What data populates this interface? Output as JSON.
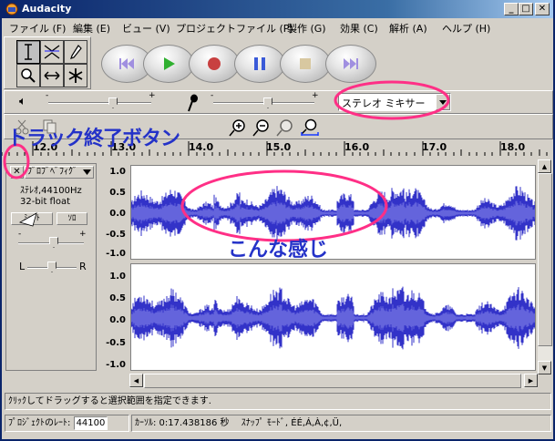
{
  "window": {
    "title": "Audacity"
  },
  "menu": [
    {
      "label": "ファイル (F)"
    },
    {
      "label": "編集 (E)"
    },
    {
      "label": "ビュー (V)"
    },
    {
      "label": "プロジェクトファイル (P)"
    },
    {
      "label": "製作 (G)"
    },
    {
      "label": "効果 (C)"
    },
    {
      "label": "解析 (A)"
    },
    {
      "label": "ヘルプ (H)"
    }
  ],
  "mixer": {
    "input_source": "ステレオ ミキサー",
    "meter_minus": "-",
    "meter_plus": "+"
  },
  "ruler": {
    "labels": [
      "12.0",
      "13.0",
      "14.0",
      "15.0",
      "16.0",
      "17.0",
      "18.0"
    ]
  },
  "track": {
    "name": "ﾌﾞﾛﾌﾞﾍﾞﾌｨｸﾞ",
    "info_rate": "ｽﾃﾚｵ,44100Hz",
    "info_format": "32-bit float",
    "mute_label": "ﾐｭｰﾄ",
    "solo_label": "ｿﾛ",
    "pan_left": "L",
    "pan_right": "R",
    "gain_minus": "-",
    "gain_plus": "+",
    "close_glyph": "✕",
    "scale_top": [
      "1.0",
      "0.5",
      "0.0",
      "-0.5",
      "-1.0"
    ],
    "scale_bottom": [
      "1.0",
      "0.5",
      "0.0",
      "-0.5",
      "-1.0"
    ]
  },
  "annotations": {
    "close_button_label": "トラック終了ボタン",
    "waveform_label": "こんな感じ"
  },
  "status": {
    "line1": "ｸﾘｯｸしてドラッグすると選択範囲を指定できます.",
    "project_rate_label": "ﾌﾟﾛｼﾞｪｸﾄのﾚｰﾄ:",
    "project_rate_value": "44100",
    "cursor_label": "ｶｰｿﾙ: 0:17.438186 秒",
    "snap_label": "ｽﾅｯﾌﾟ ﾓｰﾄﾞ, ÉÉ,Á,À,¢,Ü,"
  },
  "colors": {
    "waveform_dark": "#3232c8",
    "waveform_light": "#6464dc",
    "annotation": "#ff2f86",
    "annotation_text": "#2432c8",
    "title_bar": "#0a246a"
  },
  "icons": {
    "app": "audacity-icon",
    "minimize": "minimize-icon",
    "maximize": "maximize-icon",
    "close": "close-icon",
    "tools": [
      "selection-tool-icon",
      "envelope-tool-icon",
      "draw-tool-icon",
      "zoom-tool-icon",
      "timeshift-tool-icon",
      "multi-tool-icon"
    ],
    "transport": [
      "skip-start-icon",
      "play-icon",
      "record-icon",
      "pause-icon",
      "stop-icon",
      "skip-end-icon"
    ]
  }
}
